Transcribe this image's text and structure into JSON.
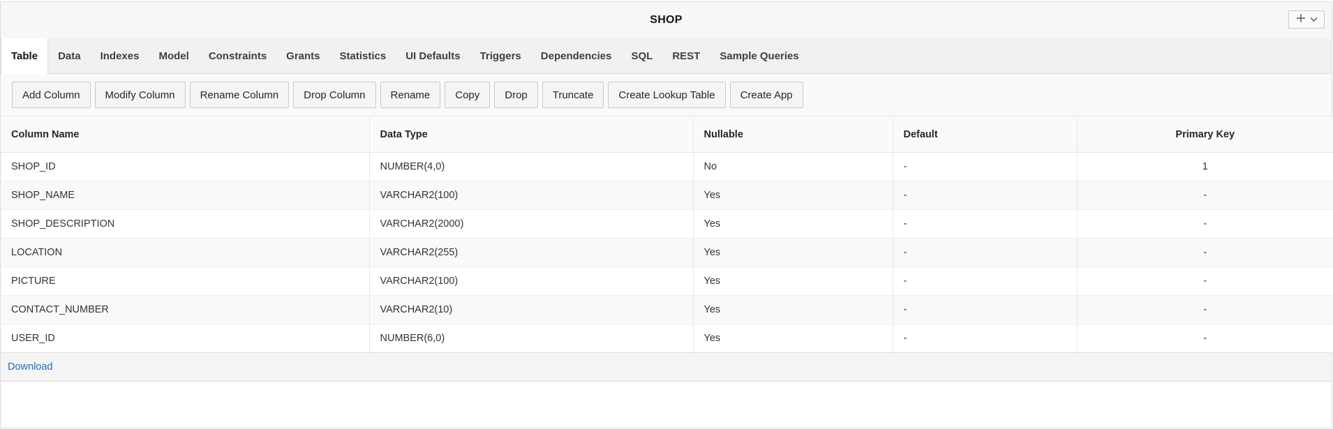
{
  "header": {
    "title": "SHOP",
    "menu_icons": [
      "plus-icon",
      "chevron-down-icon"
    ]
  },
  "tabs": [
    {
      "label": "Table",
      "active": true
    },
    {
      "label": "Data"
    },
    {
      "label": "Indexes"
    },
    {
      "label": "Model"
    },
    {
      "label": "Constraints"
    },
    {
      "label": "Grants"
    },
    {
      "label": "Statistics"
    },
    {
      "label": "UI Defaults"
    },
    {
      "label": "Triggers"
    },
    {
      "label": "Dependencies"
    },
    {
      "label": "SQL"
    },
    {
      "label": "REST"
    },
    {
      "label": "Sample Queries"
    }
  ],
  "toolbar": {
    "buttons": [
      "Add Column",
      "Modify Column",
      "Rename Column",
      "Drop Column",
      "Rename",
      "Copy",
      "Drop",
      "Truncate",
      "Create Lookup Table",
      "Create App"
    ]
  },
  "table": {
    "columns": [
      "Column Name",
      "Data Type",
      "Nullable",
      "Default",
      "Primary Key"
    ],
    "rows": [
      [
        "SHOP_ID",
        "NUMBER(4,0)",
        "No",
        "-",
        "1"
      ],
      [
        "SHOP_NAME",
        "VARCHAR2(100)",
        "Yes",
        "-",
        "-"
      ],
      [
        "SHOP_DESCRIPTION",
        "VARCHAR2(2000)",
        "Yes",
        "-",
        "-"
      ],
      [
        "LOCATION",
        "VARCHAR2(255)",
        "Yes",
        "-",
        "-"
      ],
      [
        "PICTURE",
        "VARCHAR2(100)",
        "Yes",
        "-",
        "-"
      ],
      [
        "CONTACT_NUMBER",
        "VARCHAR2(10)",
        "Yes",
        "-",
        "-"
      ],
      [
        "USER_ID",
        "NUMBER(6,0)",
        "Yes",
        "-",
        "-"
      ]
    ]
  },
  "footer": {
    "download_label": "Download"
  },
  "colors": {
    "link": "#1a6bbf",
    "tab_bar": "#f1f1f1",
    "border": "#dcdcdc"
  }
}
